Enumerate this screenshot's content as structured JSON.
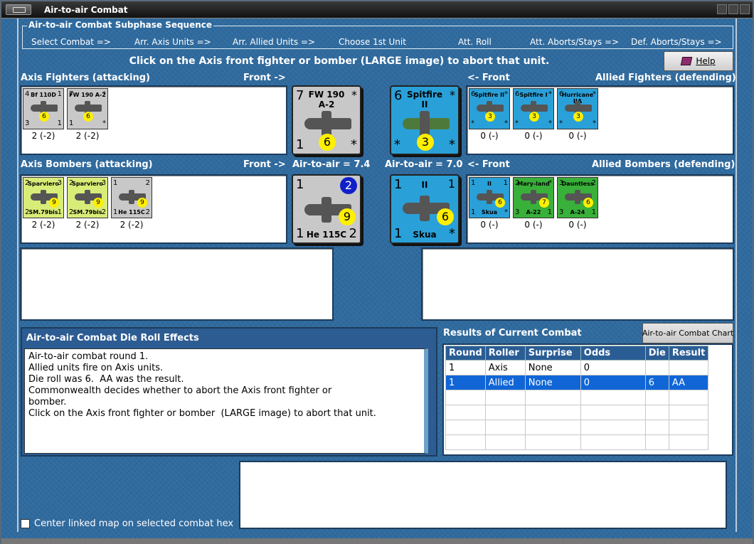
{
  "window": {
    "title": "Air-to-air Combat"
  },
  "subphase": {
    "title": "Air-to-air Combat Subphase Sequence",
    "steps": [
      "Select Combat =>",
      "Arr. Axis Units =>",
      "Arr. Allied Units =>",
      "Choose 1st Unit",
      "Att. Roll",
      "Att. Aborts/Stays =>",
      "Def. Aborts/Stays =>"
    ]
  },
  "instruction": "Click on the Axis front fighter or bomber  (LARGE image) to abort that unit.",
  "help_button": {
    "label": "Help"
  },
  "labels": {
    "axis_fighters": "Axis Fighters (attacking)",
    "axis_front_top": "Front ->",
    "allied_front_top": "<- Front",
    "allied_fighters": "Allied Fighters (defending)",
    "axis_bombers": "Axis Bombers (attacking)",
    "axis_front_bottom": "Front ->",
    "axis_a2a": "Air-to-air = 7.4",
    "allied_a2a": "Air-to-air = 7.0",
    "allied_front_bottom": "<- Front",
    "allied_bombers": "Allied Bombers (defending)"
  },
  "axis_fighters": [
    {
      "name": "Bf 110D",
      "tl": "4",
      "tr": "1",
      "bl": "3",
      "br": "1",
      "die": "6",
      "value": "2 (-2)",
      "color": "#c8c8c8"
    },
    {
      "name": "FW 190 A-2",
      "tl": "7",
      "tr": "*",
      "bl": "1",
      "br": "*",
      "die": "6",
      "value": "2 (-2)",
      "color": "#c8c8c8"
    }
  ],
  "allied_fighters": [
    {
      "name": "Spitfire II",
      "tl": "6",
      "tr": "*",
      "bl": "*",
      "br": "*",
      "die": "3",
      "value": "0 (-)",
      "color": "#2aa0d8"
    },
    {
      "name": "Spitfire I",
      "tl": "6",
      "tr": "*",
      "bl": "*",
      "br": "*",
      "die": "3",
      "value": "0 (-)",
      "color": "#2aa0d8"
    },
    {
      "name": "Hurricane IIA",
      "tl": "6",
      "tr": "*",
      "bl": "*",
      "br": "*",
      "die": "3",
      "value": "0 (-)",
      "color": "#2aa0d8"
    }
  ],
  "axis_bombers": [
    {
      "name": "Sparviero",
      "name_b": "SM.79bis",
      "tl": "2",
      "tr": "3",
      "bl": "2",
      "br": "1",
      "die": "9",
      "value": "2 (-2)",
      "color": "#d8ec78"
    },
    {
      "name": "Sparviero",
      "name_b": "SM.79bis",
      "tl": "2",
      "tr": "3",
      "bl": "2",
      "br": "2",
      "die": "9",
      "value": "2 (-2)",
      "color": "#d8ec78"
    },
    {
      "name": "",
      "name_b": "He 115C",
      "tl": "1",
      "tr": "2",
      "bl": "1",
      "br": "2",
      "die": "9",
      "value": "2 (-2)",
      "color": "#c8c8c8",
      "blue": true
    }
  ],
  "allied_bombers": [
    {
      "name": "II",
      "name_b": "Skua",
      "tl": "1",
      "tr": "1",
      "bl": "1",
      "br": "*",
      "die": "6",
      "value": "0 (-)",
      "color": "#2aa0d8"
    },
    {
      "name": "Mary-land",
      "name_b": "A-22",
      "tl": "2",
      "tr": "*",
      "bl": "3",
      "br": "1",
      "die": "7",
      "value": "0 (-)",
      "color": "#39b039"
    },
    {
      "name": "Dauntless",
      "name_b": "A-24",
      "tl": "3",
      "tr": "2",
      "bl": "3",
      "br": "1",
      "die": "6",
      "value": "0 (-)",
      "color": "#39b039"
    }
  ],
  "front": {
    "axis_fighter": {
      "name": "FW 190",
      "sub": "A-2",
      "tl": "7",
      "tr": "*",
      "bl": "1",
      "br": "*",
      "die": "6"
    },
    "allied_fighter": {
      "name": "Spitfire",
      "sub": "II",
      "tl": "6",
      "tr": "*",
      "bl": "*",
      "br": "*",
      "die": "3"
    },
    "axis_bomber": {
      "name": "He 115C",
      "tl": "1",
      "tr": "2",
      "bl": "1",
      "br": "2",
      "die": "9"
    },
    "allied_bomber": {
      "name": "Skua",
      "sub": "II",
      "tl": "1",
      "tr": "1",
      "bl": "1",
      "br": "*",
      "die": "6"
    }
  },
  "effects": {
    "title": "Air-to-air Combat Die Roll Effects",
    "lines": [
      "Air-to-air combat round 1.",
      "Allied units fire on Axis units.",
      "Die roll was 6.  AA was the result.",
      "Commonwealth decides whether to abort the Axis front fighter or",
      "bomber.",
      "Click on the Axis front fighter or bomber  (LARGE image) to abort that unit."
    ]
  },
  "results": {
    "title": "Results of Current Combat",
    "chart_button": "Air-to-air Combat Chart",
    "columns": [
      "Round",
      "Roller",
      "Surprise",
      "Odds",
      "Die",
      "Result"
    ],
    "rows": [
      [
        "1",
        "Axis",
        "None",
        "0",
        "",
        ""
      ],
      [
        "1",
        "Allied",
        "None",
        "0",
        "6",
        "AA"
      ]
    ],
    "selected_row": 1,
    "empty_rows": 4
  },
  "checkbox": {
    "label": "Center linked map on selected combat hex",
    "checked": false
  }
}
